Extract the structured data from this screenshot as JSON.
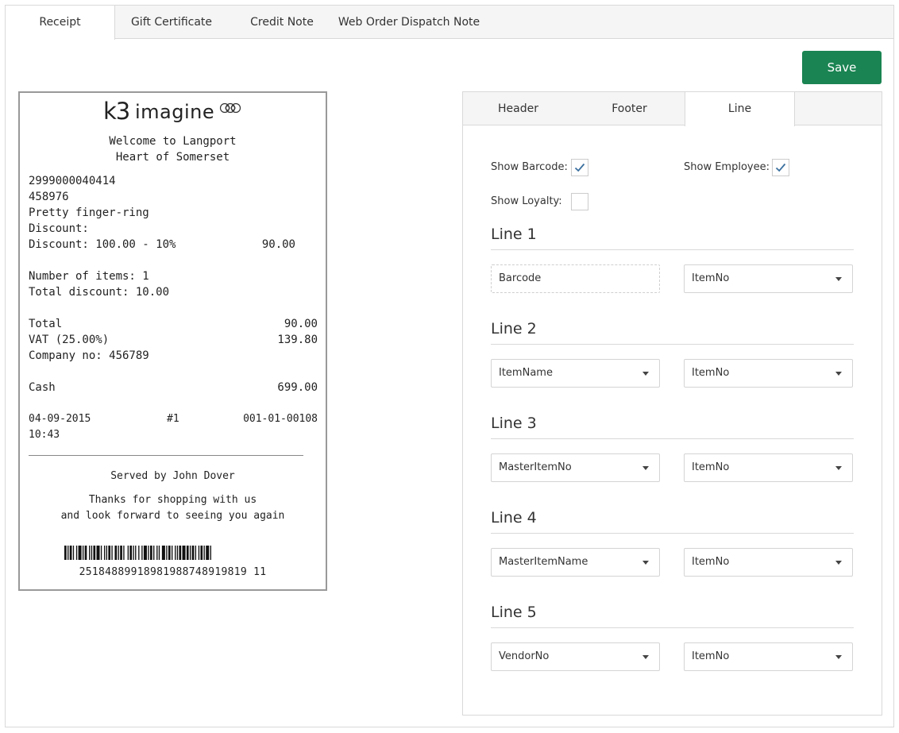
{
  "tabs": [
    "Receipt",
    "Gift Certificate",
    "Credit Note",
    "Web Order Dispatch Note"
  ],
  "save_label": "Save",
  "receipt": {
    "logo_k3": "k3",
    "logo_word": "imagine",
    "welcome": "Welcome to Langport",
    "subtitle": "Heart of Somerset",
    "barcode_line": "2999000040414",
    "item_no": "458976",
    "item_name": "Pretty finger-ring",
    "discount_label": "Discount:",
    "discount_detail": "Discount: 100.00 - 10%",
    "discount_amount": "90.00",
    "items_count": "Number of items: 1",
    "total_discount": "Total discount: 10.00",
    "total_label": "Total",
    "total_value": "90.00",
    "vat_label": "VAT (25.00%)",
    "vat_value": "139.80",
    "company_no": "Company no: 456789",
    "cash_label": "Cash",
    "cash_value": "699.00",
    "date": "04-09-2015",
    "register": "#1",
    "receipt_no": "001-01-00108",
    "time": "10:43",
    "served_by": "Served by John Dover",
    "thanks_1": "Thanks for shopping with us",
    "thanks_2": "and look forward to seeing you again",
    "barcode_number": "25184889918981988748919819 11"
  },
  "config": {
    "subtabs": [
      "Header",
      "Footer",
      "Line"
    ],
    "show_barcode_label": "Show Barcode:",
    "show_employee_label": "Show Employee:",
    "show_loyalty_label": "Show Loyalty:",
    "show_barcode": true,
    "show_employee": true,
    "show_loyalty": false,
    "lines": [
      {
        "title": "Line 1",
        "left": "Barcode",
        "right": "ItemNo"
      },
      {
        "title": "Line 2",
        "left": "ItemName",
        "right": "ItemNo"
      },
      {
        "title": "Line 3",
        "left": "MasterItemNo",
        "right": "ItemNo"
      },
      {
        "title": "Line 4",
        "left": "MasterItemName",
        "right": "ItemNo"
      },
      {
        "title": "Line 5",
        "left": "VendorNo",
        "right": "ItemNo"
      }
    ]
  },
  "colors": {
    "save_green": "#1a8452",
    "check_blue": "#3a6f9e"
  },
  "icons": [
    "checkmark-icon",
    "chevron-down-icon",
    "barcode-icon",
    "logo-rings-icon"
  ]
}
